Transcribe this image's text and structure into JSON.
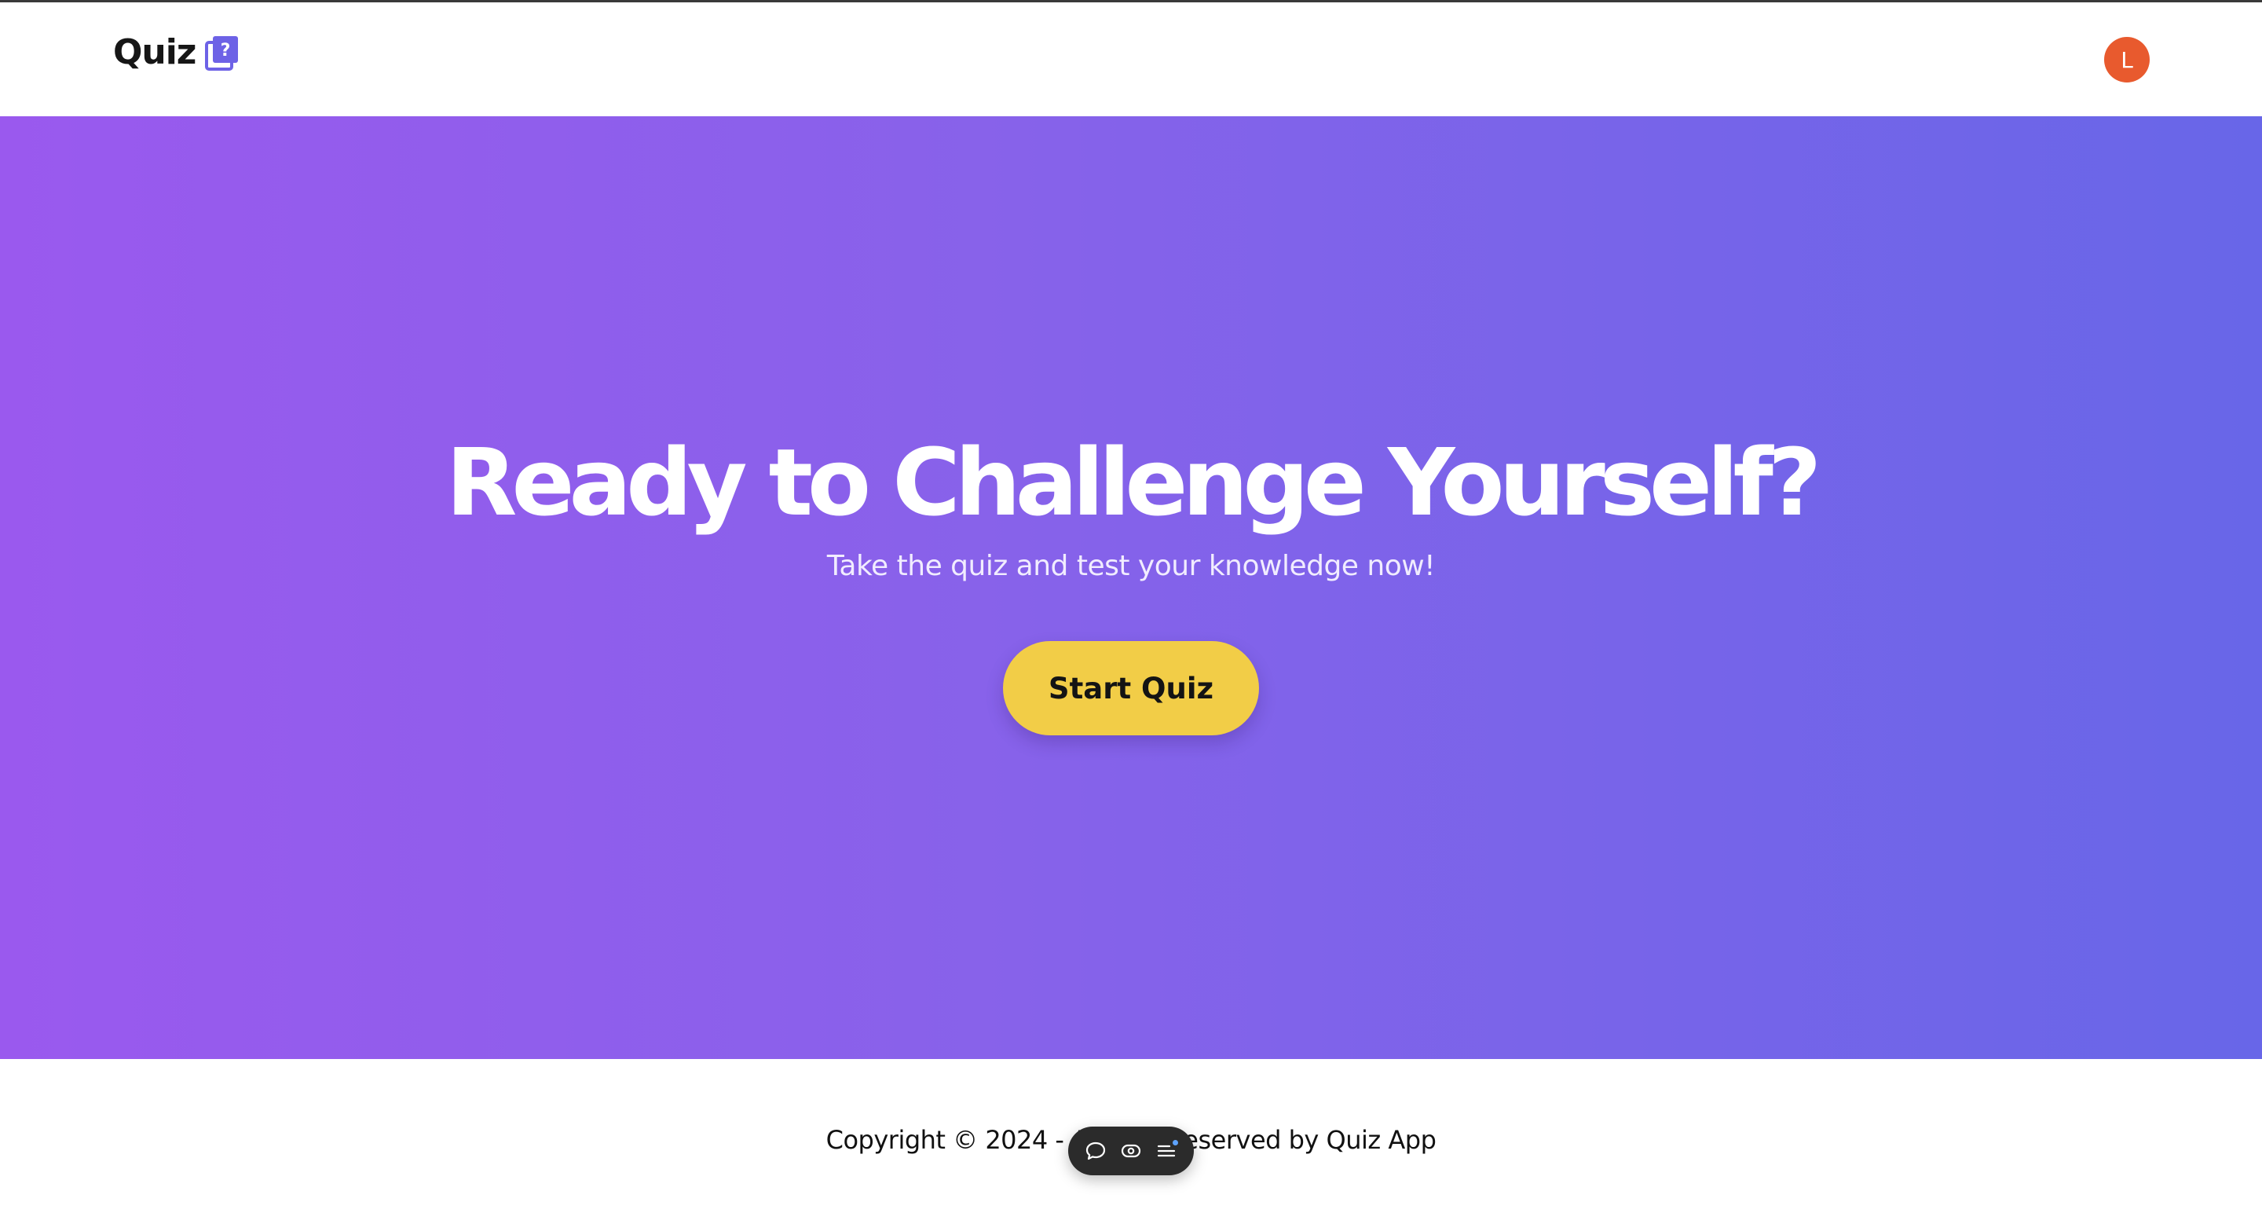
{
  "header": {
    "brand": "Quiz",
    "brand_icon": "question-book-icon",
    "brand_icon_glyph": "?",
    "avatar_initial": "L",
    "avatar_color": "#e85a2e"
  },
  "hero": {
    "title": "Ready to Challenge Yourself?",
    "subtitle": "Take the quiz and test your knowledge now!",
    "cta_label": "Start Quiz",
    "gradient_start": "#9a59ee",
    "gradient_end": "#6866e8",
    "cta_color": "#f2cd47"
  },
  "footer": {
    "copyright": "Copyright © 2024 - All right reserved by Quiz App"
  },
  "toolbar": {
    "items": [
      {
        "icon": "comment-icon"
      },
      {
        "icon": "eye-icon"
      },
      {
        "icon": "list-icon"
      }
    ]
  }
}
